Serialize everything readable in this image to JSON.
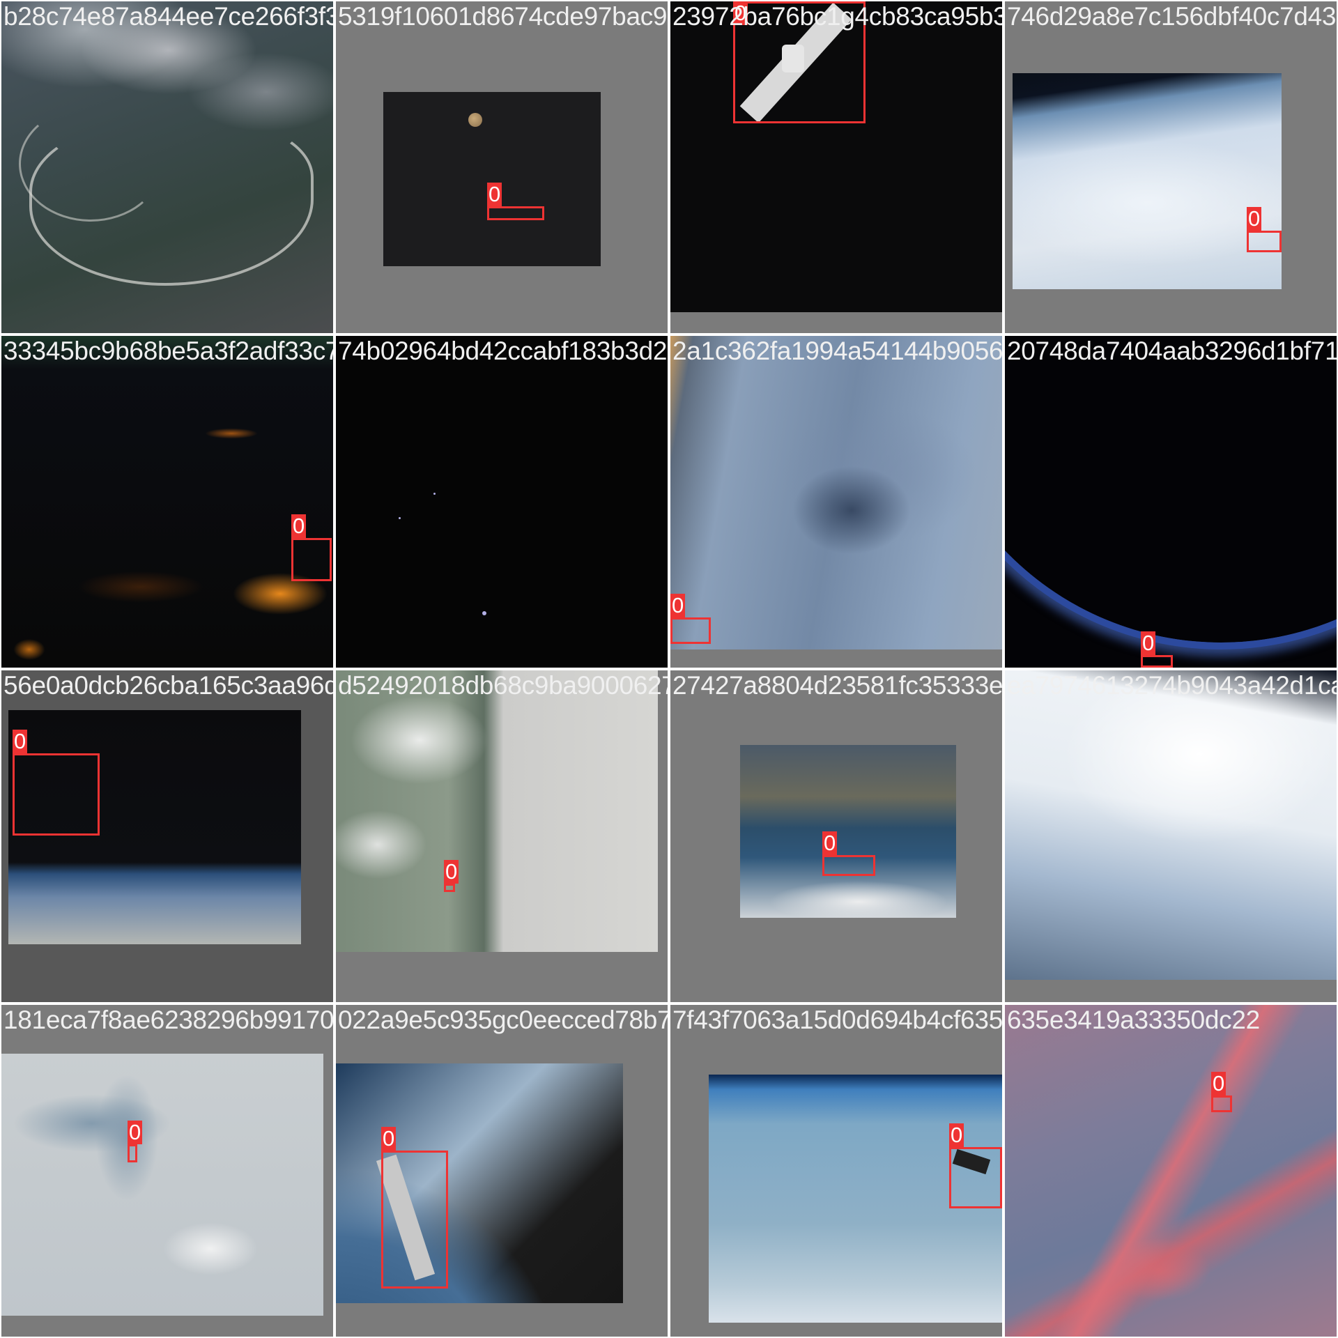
{
  "tiles": [
    {
      "filename": "b28c74e87a844ee7ce266f3f31974d6a1.png",
      "label": ""
    },
    {
      "filename": "5319f10601d8674cde97bac92e72aa2bc1g4cb83ca95b.png",
      "label": "0"
    },
    {
      "filename": "23972ba76bc1g4cb83ca95b39144d5387c156dbf40c7d43",
      "label": "0"
    },
    {
      "filename": "746d29a8e7c156dbf40c7d43",
      "label": "0"
    },
    {
      "filename": "33345bc9b68be5a3f2adf33c74b02964bd42ccabf183b3d2",
      "label": "0"
    },
    {
      "filename": "74b02964bd42ccabf183b3d2a1c362fa1994a54144b905",
      "label": ""
    },
    {
      "filename": "2a1c362fa1994a54144b90562d74a8da7404aab3296d1bf71",
      "label": "0"
    },
    {
      "filename": "20748da7404aab3296d1bf71",
      "label": "0"
    },
    {
      "filename": "56e0a0dcb26cba165c3aa96d52492018db68c9ba900062742",
      "label": "0"
    },
    {
      "filename": "d52492018db68c9ba9000627427a880e4d23581fc35333",
      "label": "0"
    },
    {
      "filename": "27427a8804d23581fc35333ea7974613274b9043a42d1ca",
      "label": "0"
    },
    {
      "filename": "ea7974613274b9043a42d1ca",
      "label": ""
    },
    {
      "filename": "181eca7f8ae6238296b9917022a9e5c935gc0eecced78b77f43f7063",
      "label": "0"
    },
    {
      "filename": "022a9e5c935gc0eecced78b77f43f7063a15d0d694b4cf",
      "label": "0"
    },
    {
      "filename": "7f43f7063a15d0d694b4cf635e3419a33350dc22",
      "label": "0"
    },
    {
      "filename": "635e3419a33350dc22",
      "label": "0"
    }
  ]
}
